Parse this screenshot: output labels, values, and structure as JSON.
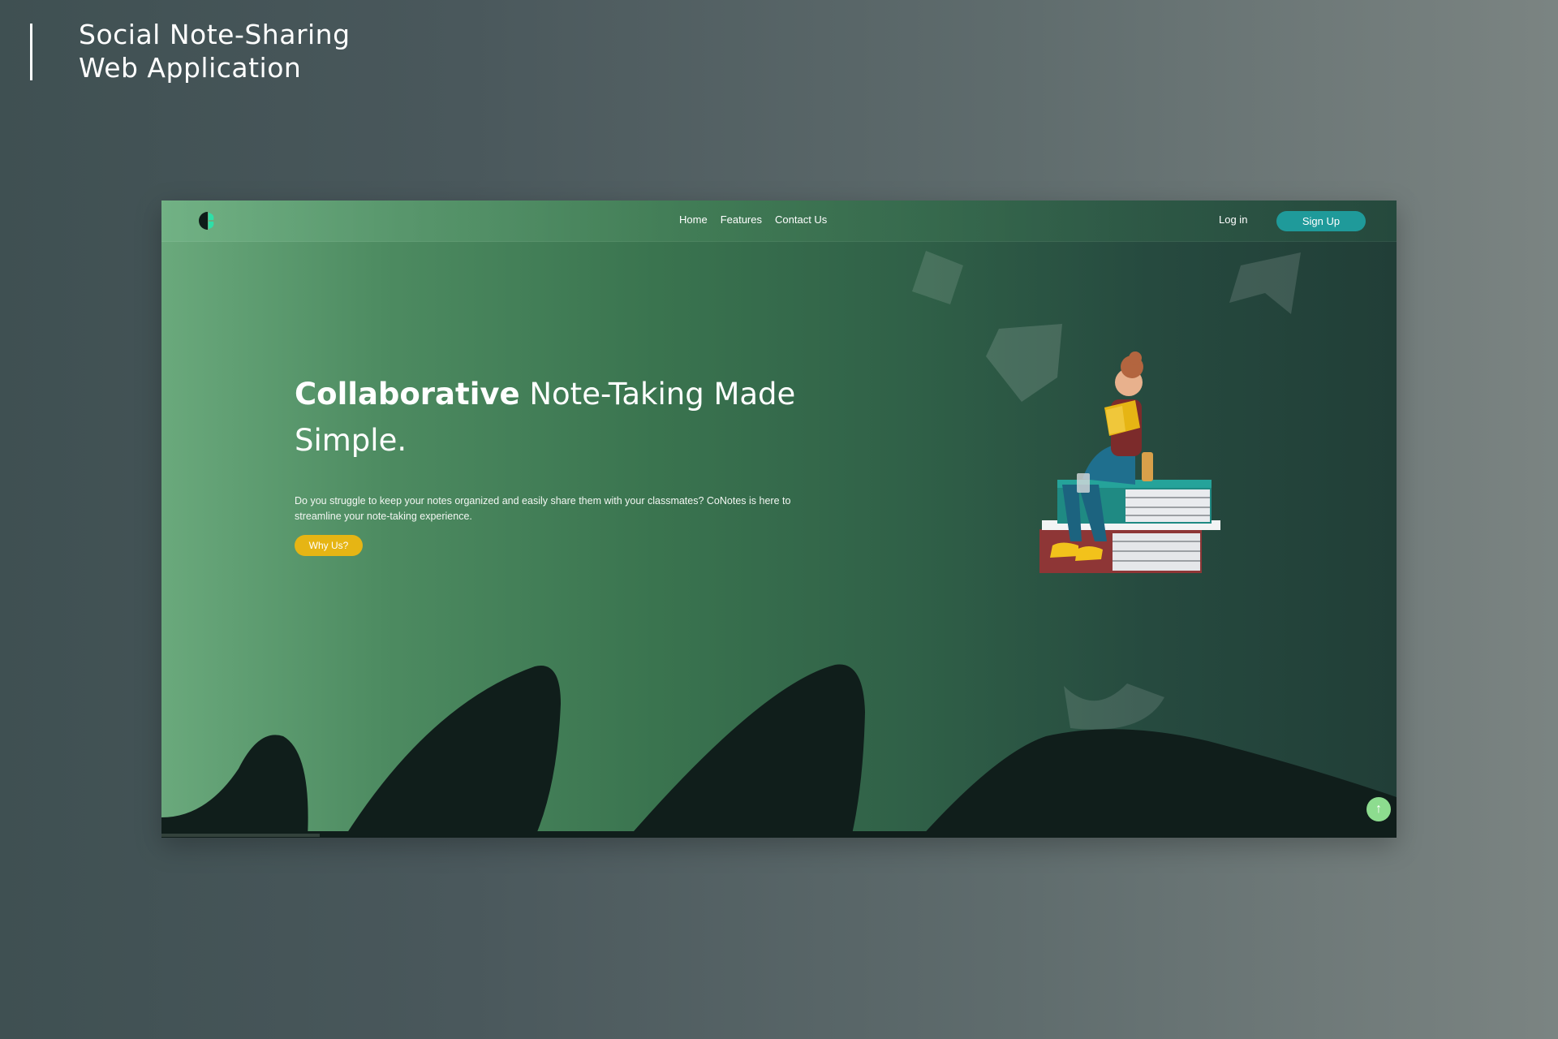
{
  "presentation": {
    "title_line1": "Social Note-Sharing",
    "title_line2": "Web Application"
  },
  "nav": {
    "logo_icon": "conotes-logo-icon",
    "links": [
      "Home",
      "Features",
      "Contact Us"
    ],
    "login": "Log in",
    "signup": "Sign Up"
  },
  "hero": {
    "headline_strong": "Collaborative",
    "headline_rest": " Note-Taking Made Simple.",
    "description": "Do you struggle to keep your notes organized and easily share them with your classmates? CoNotes is here to streamline your note-taking experience.",
    "cta": "Why Us?"
  },
  "illustration": {
    "subject": "girl-reading-on-book-stack-illustration"
  },
  "scroll_top_icon": "↑",
  "colors": {
    "accent_teal": "#1f9a9a",
    "cta_yellow": "#e6b514",
    "scroll_green": "#8ddc8f"
  }
}
